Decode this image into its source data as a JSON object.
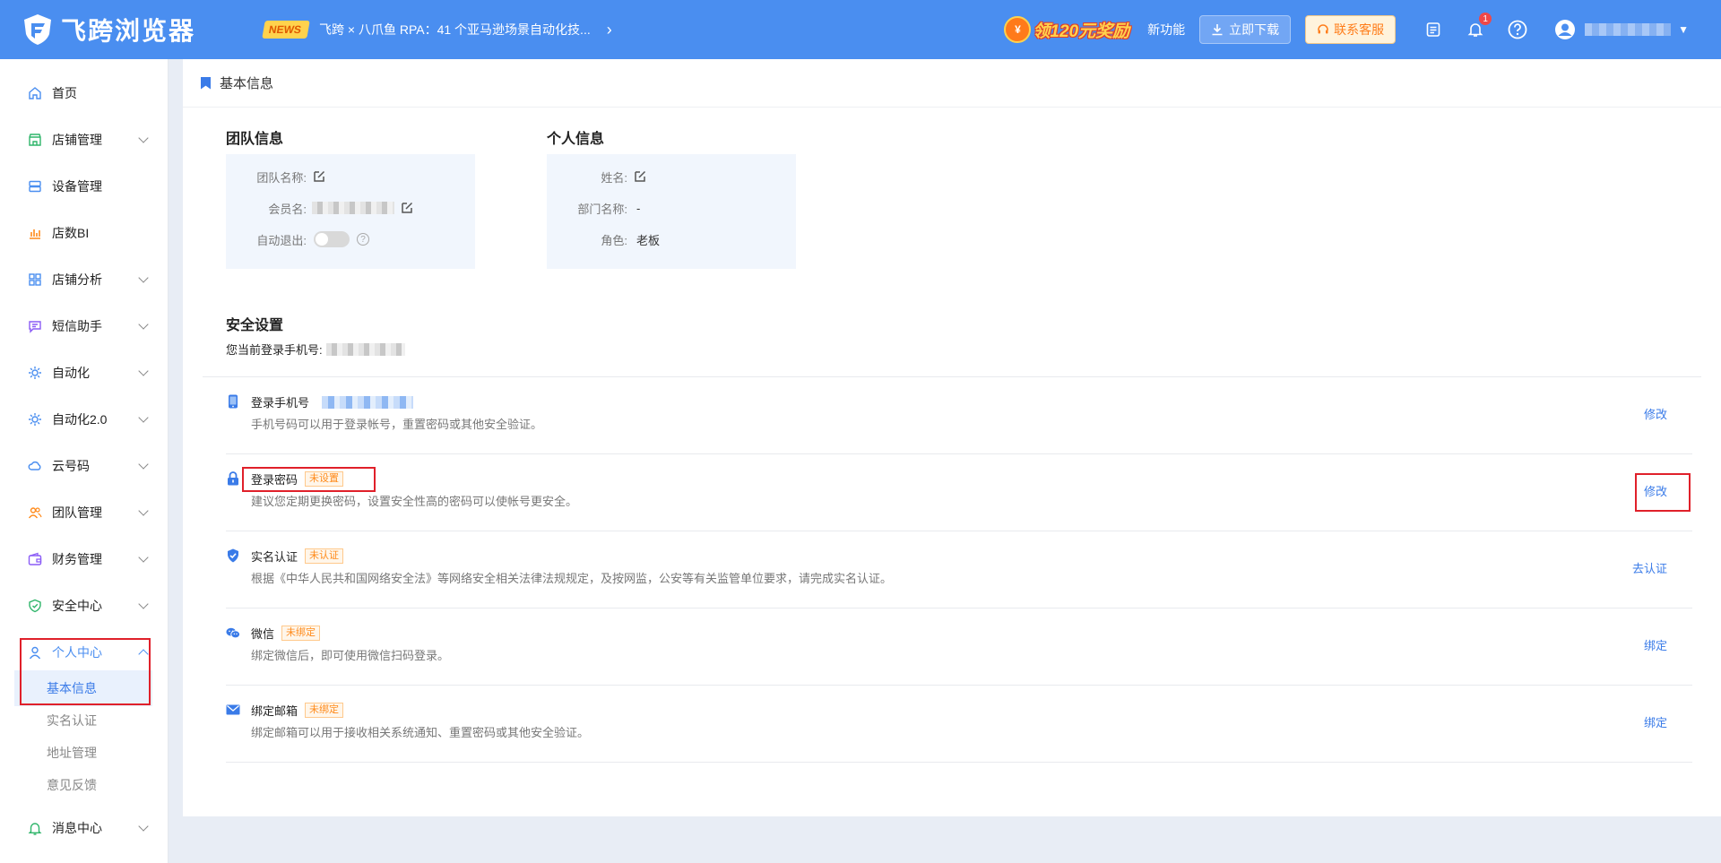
{
  "header": {
    "brand": "飞跨浏览器",
    "news_badge": "NEWS",
    "news_text": "飞跨 × 八爪鱼 RPA：41 个亚马逊场景自动化技...",
    "promo_text": "领120元奖励",
    "promo_coin": "¥",
    "new_feature": "新功能",
    "download_label": "立即下载",
    "service_label": "联系客服",
    "notification_count": "1"
  },
  "sidebar": {
    "items": [
      {
        "label": "首页",
        "icon": "home-icon"
      },
      {
        "label": "店铺管理",
        "icon": "store-icon"
      },
      {
        "label": "设备管理",
        "icon": "device-icon"
      },
      {
        "label": "店数BI",
        "icon": "chart-icon"
      },
      {
        "label": "店铺分析",
        "icon": "grid-icon"
      },
      {
        "label": "短信助手",
        "icon": "message-icon"
      },
      {
        "label": "自动化",
        "icon": "automation-icon"
      },
      {
        "label": "自动化2.0",
        "icon": "automation-icon"
      },
      {
        "label": "云号码",
        "icon": "cloud-icon"
      },
      {
        "label": "团队管理",
        "icon": "team-icon"
      },
      {
        "label": "财务管理",
        "icon": "wallet-icon"
      },
      {
        "label": "安全中心",
        "icon": "shield-icon"
      },
      {
        "label": "个人中心",
        "icon": "user-icon"
      },
      {
        "label": "消息中心",
        "icon": "bell-icon"
      }
    ],
    "sub_items": [
      "基本信息",
      "实名认证",
      "地址管理",
      "意见反馈"
    ]
  },
  "page": {
    "title": "基本信息",
    "team_info": {
      "title": "团队信息",
      "team_name_label": "团队名称:",
      "member_name_label": "会员名:",
      "auto_logout_label": "自动退出:"
    },
    "personal_info": {
      "title": "个人信息",
      "name_label": "姓名:",
      "dept_label": "部门名称:",
      "dept_value": "-",
      "role_label": "角色:",
      "role_value": "老板"
    },
    "security": {
      "title": "安全设置",
      "current_phone_label": "您当前登录手机号:",
      "rows": [
        {
          "name": "登录手机号",
          "tag": "",
          "desc": "手机号码可以用于登录帐号，重置密码或其他安全验证。",
          "action": "修改",
          "icon": "phone-icon"
        },
        {
          "name": "登录密码",
          "tag": "未设置",
          "desc": "建议您定期更换密码，设置安全性高的密码可以使帐号更安全。",
          "action": "修改",
          "icon": "lock-icon"
        },
        {
          "name": "实名认证",
          "tag": "未认证",
          "desc": "根据《中华人民共和国网络安全法》等网络安全相关法律法规规定，及按网监，公安等有关监管单位要求，请完成实名认证。",
          "action": "去认证",
          "icon": "verified-shield-icon"
        },
        {
          "name": "微信",
          "tag": "未绑定",
          "desc": "绑定微信后，即可使用微信扫码登录。",
          "action": "绑定",
          "icon": "wechat-icon"
        },
        {
          "name": "绑定邮箱",
          "tag": "未绑定",
          "desc": "绑定邮箱可以用于接收相关系统通知、重置密码或其他安全验证。",
          "action": "绑定",
          "icon": "mail-icon"
        }
      ]
    }
  },
  "colors": {
    "primary": "#4a8ef0",
    "link": "#3a7be8",
    "highlight_box": "#e0202a",
    "tag_orange": "#ff8a1a"
  }
}
